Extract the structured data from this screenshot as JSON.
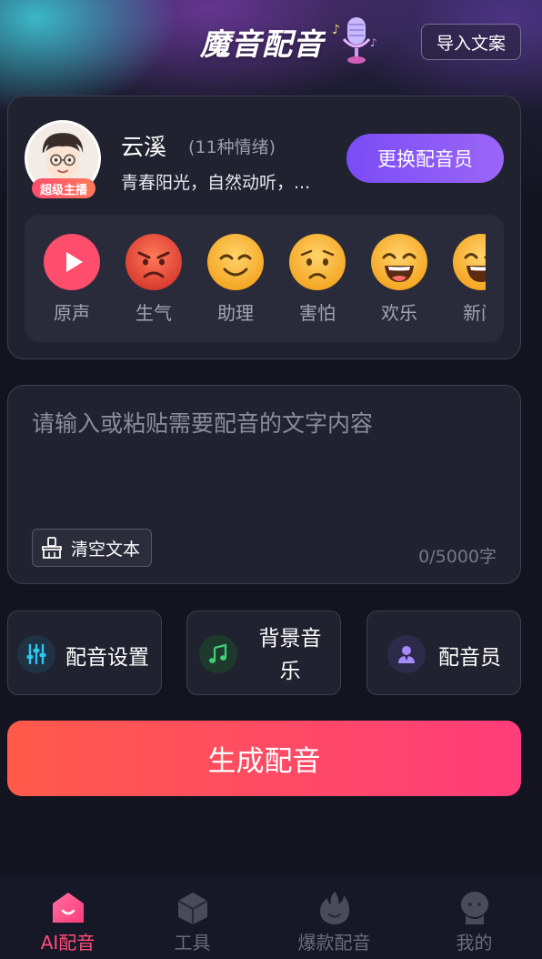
{
  "app": {
    "title": "魔音配音"
  },
  "header": {
    "import_label": "导入文案"
  },
  "voice": {
    "badge": "超级主播",
    "name": "云溪",
    "emotions_count": "(11种情绪)",
    "description": "青春阳光，自然动听，...",
    "change_label": "更换配音员"
  },
  "emotions": [
    {
      "label": "原声",
      "icon": "play-icon"
    },
    {
      "label": "生气",
      "icon": "angry-face-icon"
    },
    {
      "label": "助理",
      "icon": "smile-face-icon"
    },
    {
      "label": "害怕",
      "icon": "worried-face-icon"
    },
    {
      "label": "欢乐",
      "icon": "grin-face-icon"
    },
    {
      "label": "新闻",
      "icon": "grin-face-icon"
    }
  ],
  "editor": {
    "placeholder": "请输入或粘贴需要配音的文字内容",
    "value": "",
    "clear_label": "清空文本",
    "char_count": "0/5000字"
  },
  "options": {
    "settings_label": "配音设置",
    "music_label": "背景音乐",
    "voice_actor_label": "配音员"
  },
  "generate_label": "生成配音",
  "nav": {
    "items": [
      {
        "label": "AI配音",
        "icon": "home-smile-icon",
        "active": true
      },
      {
        "label": "工具",
        "icon": "box-icon",
        "active": false
      },
      {
        "label": "爆款配音",
        "icon": "flame-icon",
        "active": false
      },
      {
        "label": "我的",
        "icon": "profile-icon",
        "active": false
      }
    ]
  },
  "colors": {
    "background": "#13141f",
    "card": "#21222f",
    "accent_purple": "#8b5cf6",
    "accent_red": "#ff4d6d",
    "nav_active": "#ff4d7b",
    "emotion_face": "#f5a623",
    "angry_face": "#e84a3a"
  }
}
